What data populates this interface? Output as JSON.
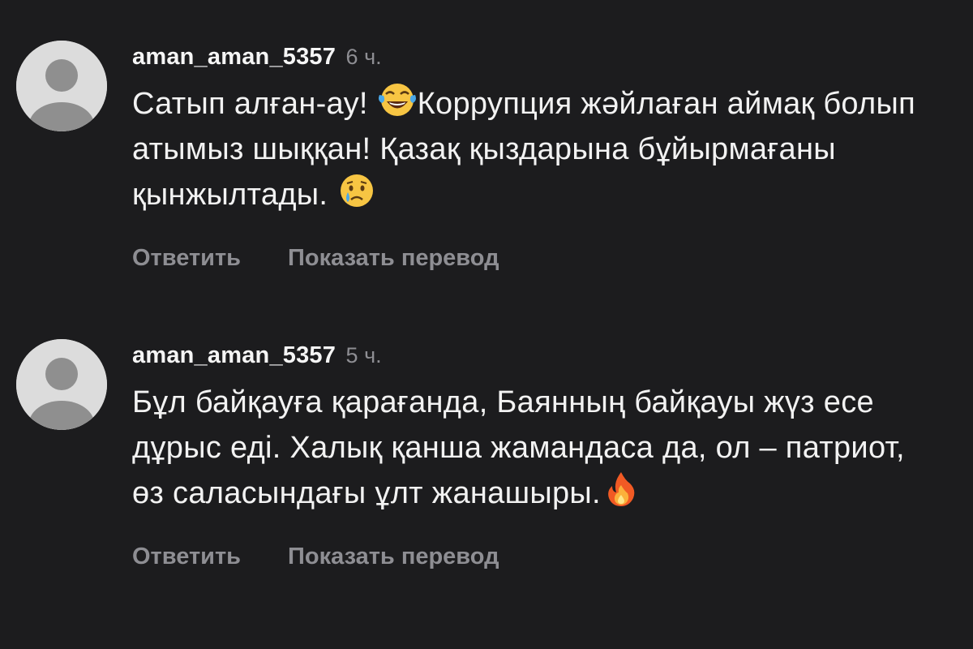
{
  "comments": [
    {
      "username": "aman_aman_5357",
      "time": "6 ч.",
      "text_parts": [
        "Сатып алған-ау! ",
        "Коррупция жәйлаған аймақ болып атымыз шыққан! Қазақ қыздарына бұйырмағаны қынжылтады. "
      ],
      "emojis": [
        "face-with-tears-of-joy-emoji",
        "crying-face-emoji"
      ],
      "reply_label": "Ответить",
      "translate_label": "Показать перевод"
    },
    {
      "username": "aman_aman_5357",
      "time": "5 ч.",
      "text_parts": [
        "Бұл байқауға қарағанда, Баянның байқауы жүз есе дұрыс еді. Халық қанша жамандаса да, ол – патриот, өз саласындағы ұлт жанашыры."
      ],
      "emojis": [
        "fire-emoji"
      ],
      "reply_label": "Ответить",
      "translate_label": "Показать перевод"
    }
  ],
  "colors": {
    "background": "#1c1c1e",
    "text": "#f2f2f2",
    "muted": "#8e8e93",
    "avatar": "#dcdcdc"
  }
}
